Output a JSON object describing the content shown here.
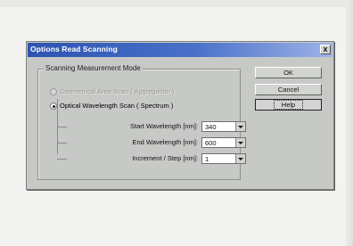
{
  "dialog": {
    "title": "Options Read Scanning",
    "close_glyph": "x"
  },
  "group": {
    "legend": "Scanning Measurement Mode",
    "options": [
      {
        "label": "Geometrical Area Scan ( Aggregation )",
        "selected": false,
        "enabled": false
      },
      {
        "label": "Optical Wavelength Scan ( Spectrum )",
        "selected": true,
        "enabled": true
      }
    ],
    "fields": [
      {
        "label": "Start Wavelength [nm]:",
        "value": "340"
      },
      {
        "label": "End Wavelength [nm]:",
        "value": "600"
      },
      {
        "label": "Increment / Step [nm]:",
        "value": "1"
      }
    ]
  },
  "buttons": {
    "ok": "OK",
    "cancel": "Cancel",
    "help": "Help"
  },
  "colors": {
    "titlebar_start": "#2c54b0",
    "dialog_face": "#c7c9c6"
  }
}
